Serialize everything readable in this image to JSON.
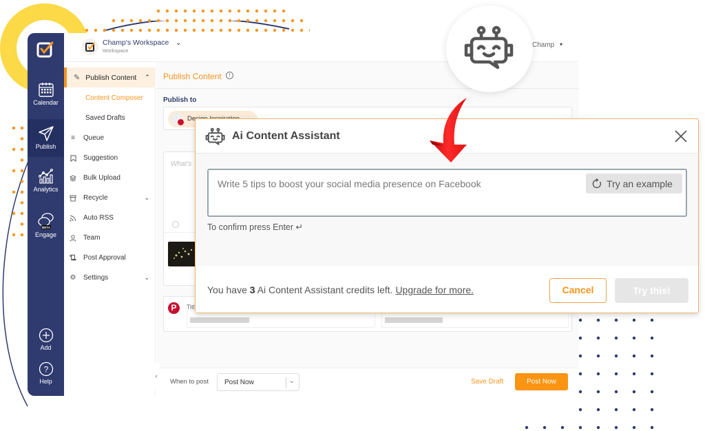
{
  "sidebar": {
    "items": [
      {
        "label": "Calendar",
        "icon": "calendar-icon"
      },
      {
        "label": "Publish",
        "icon": "paper-plane-icon",
        "active": true
      },
      {
        "label": "Analytics",
        "icon": "analytics-icon"
      },
      {
        "label": "Engage",
        "icon": "chat-bubbles-icon",
        "badge": "BETA"
      },
      {
        "label": "Add",
        "icon": "plus-circle-icon"
      },
      {
        "label": "Help",
        "icon": "question-circle-icon"
      }
    ]
  },
  "topbar": {
    "workspace_name": "Champ's Workspace",
    "workspace_sub": "Workspace",
    "user_name": "Champ"
  },
  "subnav": {
    "header": "Publish Content",
    "subitems": [
      {
        "label": "Content Composer",
        "active": true
      },
      {
        "label": "Saved Drafts",
        "active": false
      }
    ],
    "items": [
      {
        "label": "Queue",
        "icon": "list-icon"
      },
      {
        "label": "Suggestion",
        "icon": "bookmark-icon"
      },
      {
        "label": "Bulk Upload",
        "icon": "layers-icon"
      },
      {
        "label": "Recycle",
        "icon": "archive-icon",
        "expandable": true
      },
      {
        "label": "Auto RSS",
        "icon": "rss-icon"
      },
      {
        "label": "Team",
        "icon": "user-icon"
      },
      {
        "label": "Post Approval",
        "icon": "scroll-icon"
      },
      {
        "label": "Settings",
        "icon": "gear-icon",
        "expandable": true
      }
    ]
  },
  "content": {
    "title": "Publish Content",
    "publish_to_label": "Publish to",
    "account_chip": "Design Inspiration",
    "composer_placeholder": "What's",
    "pin_title_label": "Title"
  },
  "bottom_bar": {
    "when_label": "When to post",
    "when_value": "Post Now",
    "save_draft": "Save Draft",
    "post_now": "Post Now"
  },
  "modal": {
    "title": "Ai Content Assistant",
    "input_placeholder": "Write 5 tips to boost your social media presence on Facebook",
    "try_example": "Try an example",
    "hint": "To confirm press Enter ↵",
    "credits_prefix": "You have ",
    "credits_count": "3",
    "credits_suffix": " Ai Content Assistant credits left. ",
    "upgrade_link": "Upgrade for more.",
    "cancel": "Cancel",
    "try_this": "Try this!"
  },
  "colors": {
    "brand_navy": "#2f3a6e",
    "accent_orange": "#f7941d",
    "pinterest_red": "#c8102e",
    "arrow_red": "#f01414"
  }
}
